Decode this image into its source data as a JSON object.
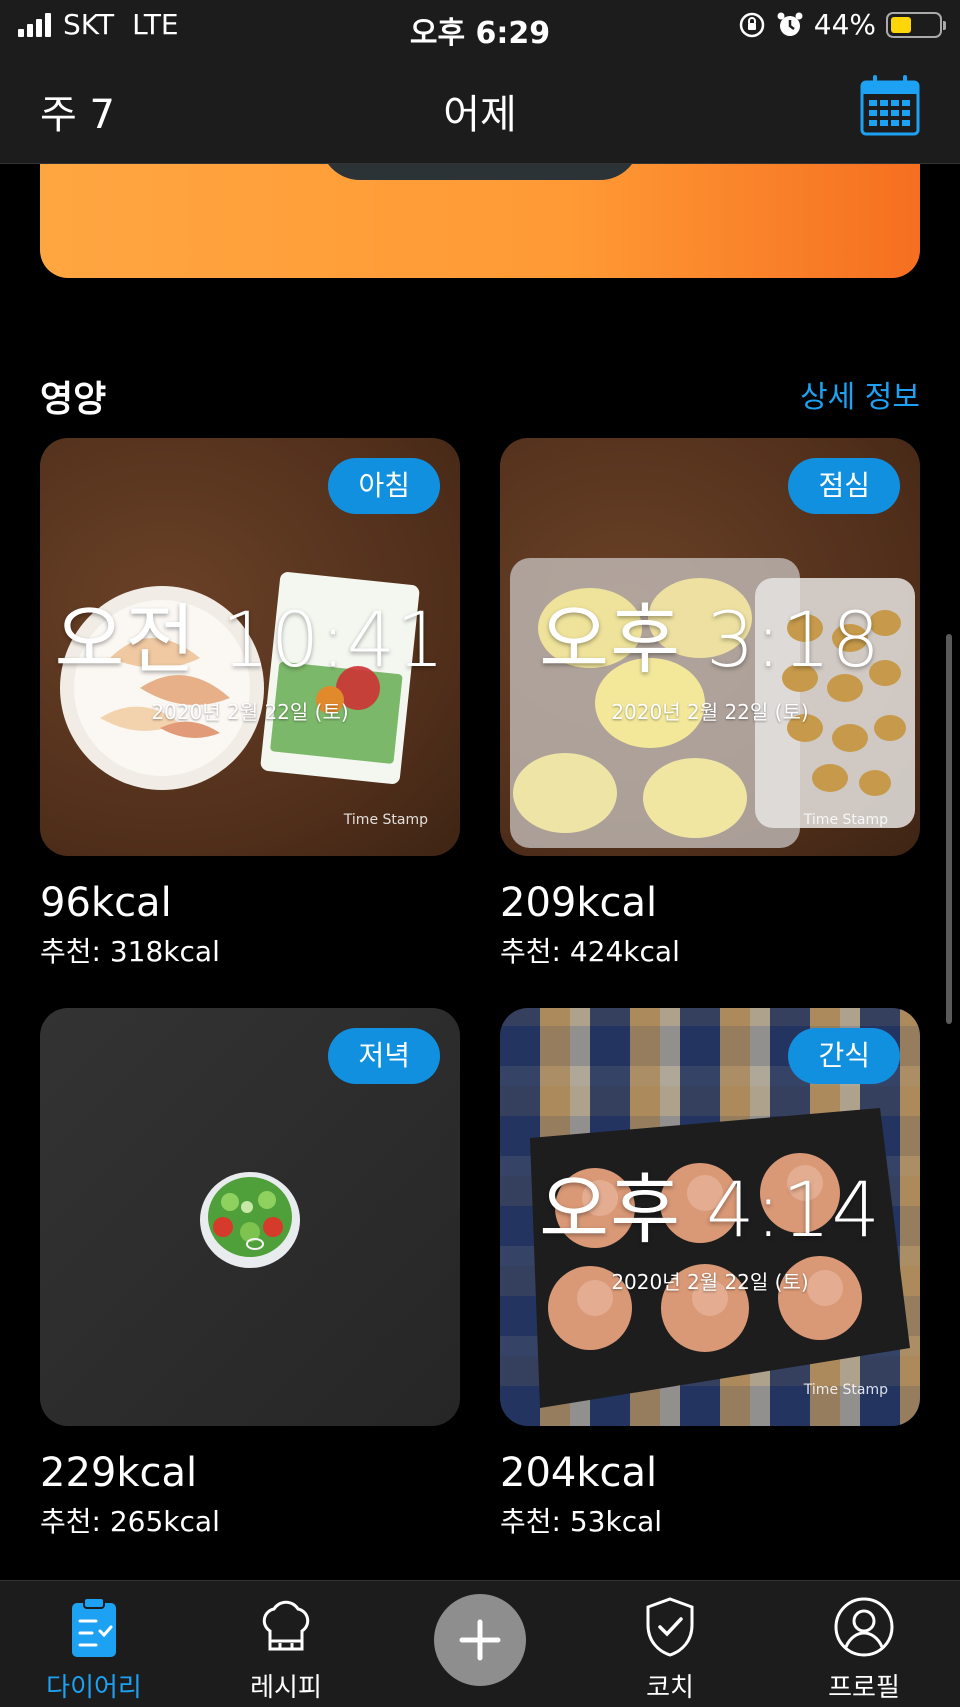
{
  "status_bar": {
    "carrier": "SKT",
    "network": "LTE",
    "time": "오후 6:29",
    "battery": "44%",
    "battery_level": 0.44
  },
  "header": {
    "week": "주 7",
    "title": "어제"
  },
  "section": {
    "title": "영양",
    "detail_link": "상세 정보"
  },
  "meals": [
    {
      "badge": "아침",
      "stamp_time": "오전 10:41",
      "stamp_date": "2020년 2월 22일 (토)",
      "stamp_mark": "Time Stamp",
      "kcal": "96kcal",
      "recommended": "추천: 318kcal"
    },
    {
      "badge": "점심",
      "stamp_time": "오후 3:18",
      "stamp_date": "2020년 2월 22일 (토)",
      "stamp_mark": "Time Stamp",
      "kcal": "209kcal",
      "recommended": "추천: 424kcal"
    },
    {
      "badge": "저녁",
      "kcal": "229kcal",
      "recommended": "추천: 265kcal"
    },
    {
      "badge": "간식",
      "stamp_time": "오후 4:14",
      "stamp_date": "2020년 2월 22일 (토)",
      "stamp_mark": "Time Stamp",
      "kcal": "204kcal",
      "recommended": "추천: 53kcal"
    }
  ],
  "tabs": [
    {
      "label": "다이어리",
      "icon": "clipboard-check-icon",
      "active": true
    },
    {
      "label": "레시피",
      "icon": "chef-hat-icon"
    },
    {
      "label": "",
      "icon": "plus-icon"
    },
    {
      "label": "코치",
      "icon": "shield-check-icon"
    },
    {
      "label": "프로필",
      "icon": "user-icon"
    }
  ],
  "colors": {
    "accent": "#1da1f2",
    "badge": "#1290e0",
    "banner_start": "#ffa641",
    "banner_end": "#f56f20"
  }
}
